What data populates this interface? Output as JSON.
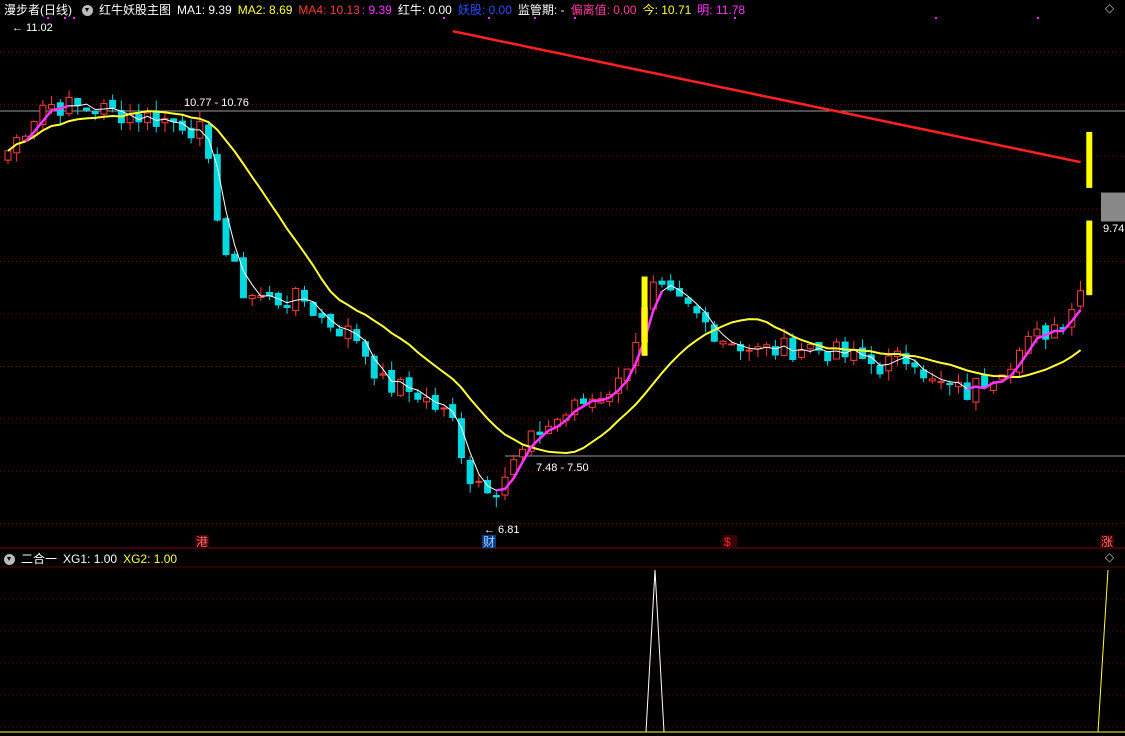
{
  "colors": {
    "up": "#ff3b3b",
    "down": "#00d8e0",
    "ma1": "#ffffff",
    "ma2": "#ffff33",
    "ma4": "#ff2020",
    "trend": "#ff33ff",
    "mark": "#ffff00",
    "grid": "#6a0000",
    "white": "#ffffff"
  },
  "header": {
    "title": "漫步者(日线)",
    "indicator": "红牛妖股主图",
    "ma1": "MA1: 9.39",
    "ma2": "MA2: 8.69",
    "ma4": "MA4: 10.13",
    "ma4b": ": 9.39",
    "hongniu": "红牛: 0.00",
    "yaogu": "妖股: 0.00",
    "jianguan": "监管期: -",
    "pianli": "偏离值: 0.00",
    "jin": "今: 10.71",
    "ming": "明: 11.78",
    "dots": "• • •"
  },
  "sub_header": {
    "title": "二合一",
    "xg1": "XG1: 1.00",
    "xg2": "XG2: 1.00"
  },
  "icons": {
    "settings": "circle-chevron-icon",
    "close": "close-icon",
    "diamond": "diamond-icon"
  },
  "chart_data": [
    {
      "type": "candlestick",
      "title": "红牛妖股主图",
      "ylim": [
        6.4,
        11.9
      ],
      "series": [
        {
          "name": "MA1",
          "values": []
        },
        {
          "name": "MA2",
          "values": []
        },
        {
          "name": "MA4",
          "values": []
        }
      ],
      "annotations": {
        "high_label": "11.02",
        "low_label": "6.81",
        "range_label_1": "10.77 - 10.76",
        "range_label_2": "7.48 - 7.50",
        "price_tag": "9.74"
      },
      "event_markers": [
        "港",
        "财",
        "$",
        "涨"
      ]
    },
    {
      "type": "line",
      "title": "二合一",
      "series": [
        {
          "name": "XG1",
          "values": []
        },
        {
          "name": "XG2",
          "values": []
        }
      ]
    }
  ]
}
